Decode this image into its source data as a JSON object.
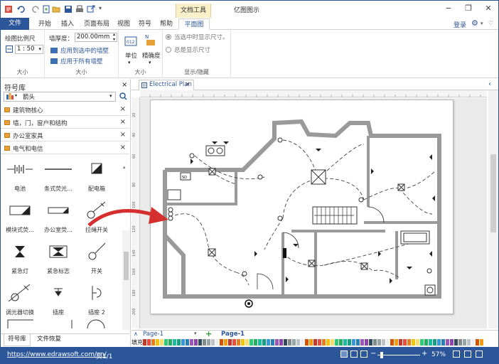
{
  "titlebar": {
    "context_tab_title": "文档工具",
    "app_title": "亿图图示",
    "minimize": "−",
    "restore": "❐",
    "close": "✕"
  },
  "ribbon_tabs": {
    "file": "文件",
    "start": "开始",
    "insert": "插入",
    "page_layout": "页面布局",
    "view": "视图",
    "symbol": "符号",
    "help": "帮助",
    "floor_plan": "平面图"
  },
  "account": {
    "login": "登录"
  },
  "ribbon": {
    "scale": {
      "label": "绘图比例尺",
      "value": "1 : 50",
      "group": "大小"
    },
    "wall": {
      "thickness_label": "墙厚度：",
      "thickness_value": "200.00mm",
      "apply_selected": "应用到选中的墙壁",
      "apply_all": "应用于所有墙壁",
      "group": "大小"
    },
    "units": {
      "unit_label": "单位",
      "precision_label": "精确度",
      "group": "大小"
    },
    "display": {
      "option_selected": "当选中时显示尺寸。",
      "option_always": "总是显示尺寸",
      "group": "显示/隐藏"
    }
  },
  "symbol_panel": {
    "title": "符号库",
    "search_value": "箭头",
    "categories": [
      "建筑物核心",
      "墙，门，窗户和结构",
      "办公室家具",
      "电气和电信"
    ],
    "symbols": [
      {
        "label": "电池"
      },
      {
        "label": "条式荧光..."
      },
      {
        "label": "配电箱"
      },
      {
        "label": "模块式荧..."
      },
      {
        "label": "办公室荧..."
      },
      {
        "label": "拉绳开关"
      },
      {
        "label": "紧急灯"
      },
      {
        "label": "紧急标志"
      },
      {
        "label": "开关"
      },
      {
        "label": "调光器切换"
      },
      {
        "label": "插座"
      },
      {
        "label": "插座 2"
      }
    ],
    "bottom_tabs": [
      "符号库",
      "文件恢复"
    ]
  },
  "document": {
    "tab_title": "Electrical Plan",
    "close": "×"
  },
  "page_bar": {
    "page_dropdown": "Page-1",
    "add": "+",
    "active_page": "Page-1",
    "fill_label": "填充"
  },
  "status": {
    "url": "https://www.edrawsoft.com/cn/",
    "page_info": "页1/1",
    "zoom": "57%"
  },
  "colors": {
    "accent": "#2b579a",
    "arrow": "#d62f2f"
  }
}
